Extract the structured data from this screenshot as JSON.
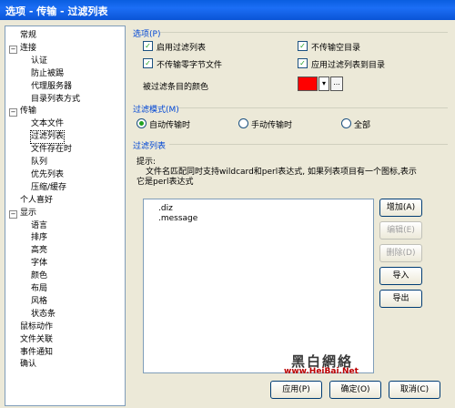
{
  "window": {
    "title": "选项 - 传输 - 过滤列表"
  },
  "tree": {
    "items": [
      {
        "label": "常规",
        "level": 0
      },
      {
        "label": "连接",
        "level": 0,
        "expander": "−"
      },
      {
        "label": "认证",
        "level": 1
      },
      {
        "label": "防止被踢",
        "level": 1
      },
      {
        "label": "代理服务器",
        "level": 1
      },
      {
        "label": "目录列表方式",
        "level": 1
      },
      {
        "label": "传输",
        "level": 0,
        "expander": "−"
      },
      {
        "label": "文本文件",
        "level": 1
      },
      {
        "label": "过滤列表",
        "level": 1,
        "selected": true
      },
      {
        "label": "文件存在时",
        "level": 1
      },
      {
        "label": "队列",
        "level": 1
      },
      {
        "label": "优先列表",
        "level": 1
      },
      {
        "label": "压缩/缓存",
        "level": 1
      },
      {
        "label": "个人喜好",
        "level": 0
      },
      {
        "label": "显示",
        "level": 0,
        "expander": "−"
      },
      {
        "label": "语言",
        "level": 1
      },
      {
        "label": "排序",
        "level": 1
      },
      {
        "label": "高亮",
        "level": 1
      },
      {
        "label": "字体",
        "level": 1
      },
      {
        "label": "颜色",
        "level": 1
      },
      {
        "label": "布局",
        "level": 1
      },
      {
        "label": "风格",
        "level": 1
      },
      {
        "label": "状态条",
        "level": 1
      },
      {
        "label": "鼠标动作",
        "level": 0
      },
      {
        "label": "文件关联",
        "level": 0
      },
      {
        "label": "事件通知",
        "level": 0
      },
      {
        "label": "确认",
        "level": 0
      }
    ]
  },
  "options": {
    "group_title": "选项(P)",
    "checkbox_enable_filter": "启用过滤列表",
    "checkbox_skip_empty_dirs": "不传输空目录",
    "checkbox_skip_zero_byte": "不传输零字节文件",
    "checkbox_apply_to_dirs": "应用过滤列表到目录",
    "filtered_color_label": "被过滤条目的颜色",
    "color_value": "#ff0000",
    "color_more_button": "..."
  },
  "mode": {
    "group_title": "过滤模式(M)",
    "auto": "自动传输时",
    "manual": "手动传输时",
    "all": "全部"
  },
  "filter_list": {
    "group_title": "过滤列表",
    "hint_title": "提示:",
    "hint_text_1": "文件名匹配同时支持wildcard和perl表达式, 如果列表项目有一个图标,表示",
    "hint_text_2": "它是perl表达式",
    "entries": [
      ".diz",
      ".message"
    ],
    "add_button": "增加(A)",
    "edit_button": "编辑(E)",
    "delete_button": "删除(D)",
    "import_button": "导入",
    "export_button": "导出"
  },
  "footer": {
    "apply_button": "应用(P)",
    "ok_button": "确定(O)",
    "cancel_button": "取消(C)"
  },
  "watermark": {
    "text_cn": "黑白網絡",
    "url": "www.HeiBai.Net"
  }
}
